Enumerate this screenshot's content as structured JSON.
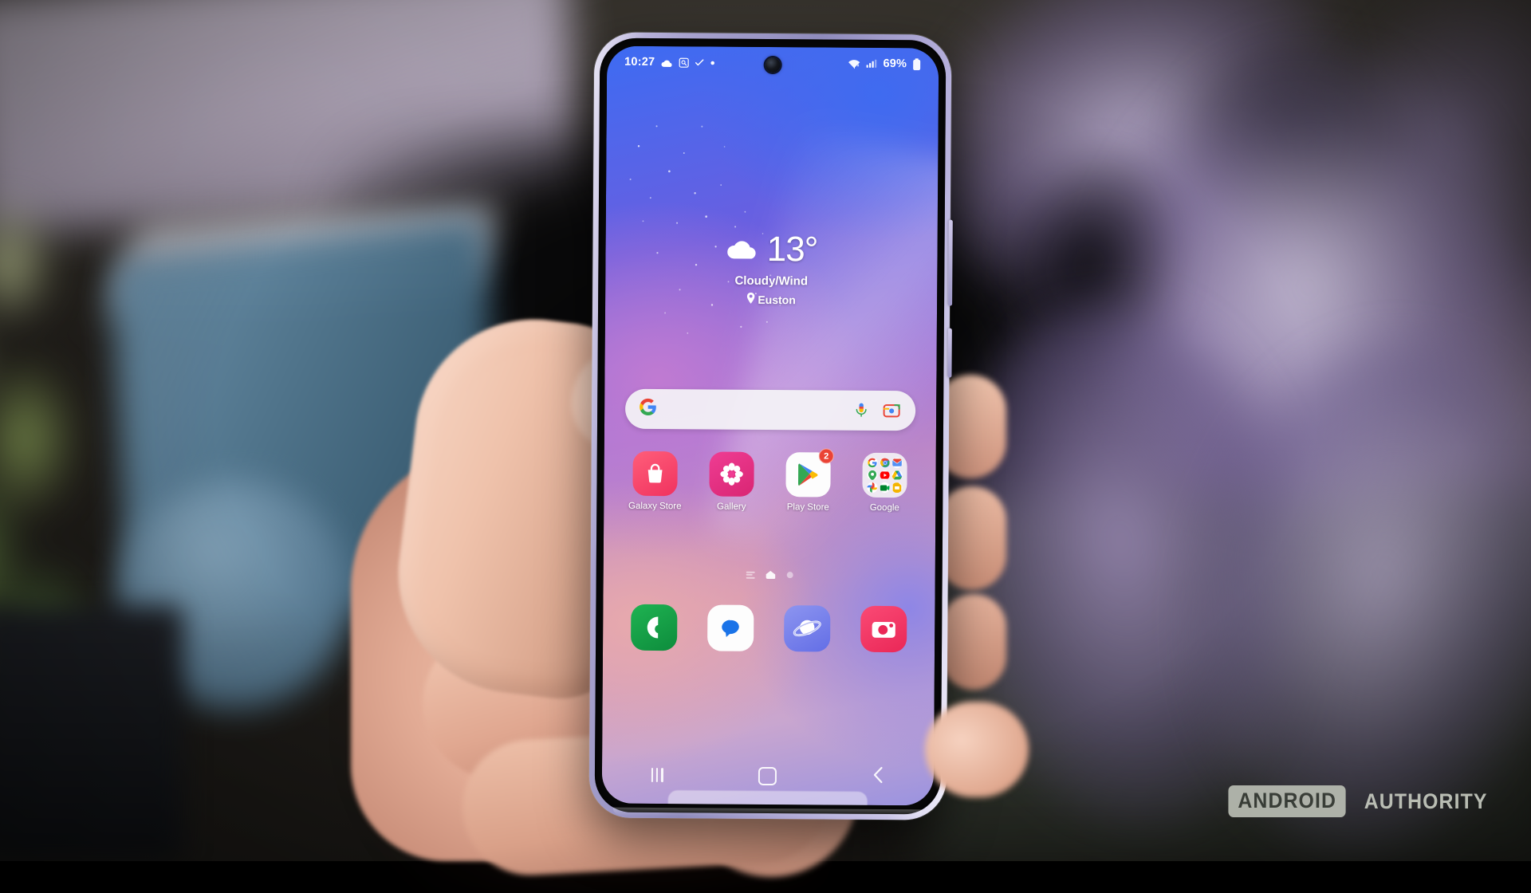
{
  "scene": {
    "description": "Hand holding a Samsung Galaxy smartphone in front of a blurred studio background",
    "background_colors": {
      "plant_green": "#8aa84f",
      "box_blue": "#52778f",
      "plume_purple": "#9b8ab8",
      "dark": "#0a0a0b"
    },
    "hand_color": "#e6b49b",
    "phone_frame_color": "#a9a3cf"
  },
  "phone": {
    "statusbar": {
      "time": "10:27",
      "left_icons": [
        "cloud-icon",
        "screen-recorder-icon",
        "checkmark-icon",
        "dot-icon"
      ],
      "right_icons": [
        "wifi-icon",
        "signal-icon"
      ],
      "battery_percent": "69%",
      "battery_icon": "battery-icon",
      "camera": "front-camera-punch-hole"
    },
    "weather": {
      "icon": "cloud-icon",
      "temperature": "13°",
      "condition": "Cloudy/Wind",
      "location": "Euston",
      "location_icon": "location-pin-icon"
    },
    "search": {
      "logo": "google-g-icon",
      "placeholder": "",
      "value": "",
      "mic_icon": "microphone-icon",
      "lens_icon": "google-lens-icon"
    },
    "apps": [
      {
        "label": "Galaxy Store",
        "icon": "galaxy-store-icon",
        "color": "#f0436e",
        "badge": null
      },
      {
        "label": "Gallery",
        "icon": "gallery-icon",
        "color": "#e0337e",
        "badge": null
      },
      {
        "label": "Play Store",
        "icon": "play-store-icon",
        "color": "#ffffff",
        "badge": "2"
      },
      {
        "label": "Google",
        "icon": "google-folder-icon",
        "color": "#f3f1f5",
        "badge": null
      }
    ],
    "folder_apps": [
      "google-icon",
      "chrome-icon",
      "gmail-icon",
      "maps-icon",
      "youtube-icon",
      "drive-icon",
      "photos-icon",
      "meet-icon",
      "slides-icon"
    ],
    "page_indicator": {
      "pages": [
        "samsung-free-page",
        "home-page",
        "secondary-page"
      ],
      "active_index": 1
    },
    "dock": [
      {
        "label": "Phone",
        "icon": "phone-icon",
        "color": "#17a24a"
      },
      {
        "label": "Messages",
        "icon": "messages-icon",
        "color": "#ffffff"
      },
      {
        "label": "Samsung Internet",
        "icon": "samsung-internet-icon",
        "color": "#7b86ea"
      },
      {
        "label": "Camera",
        "icon": "camera-icon",
        "color": "#f0386a"
      }
    ],
    "navbar": [
      {
        "name": "recents-button",
        "icon": "recents-icon"
      },
      {
        "name": "home-button",
        "icon": "home-icon"
      },
      {
        "name": "back-button",
        "icon": "back-chevron-icon"
      }
    ],
    "side_buttons": [
      "volume-rocker",
      "power-button"
    ]
  },
  "watermark": {
    "box_text": "ANDROID",
    "plain_text": "AUTHORITY"
  }
}
